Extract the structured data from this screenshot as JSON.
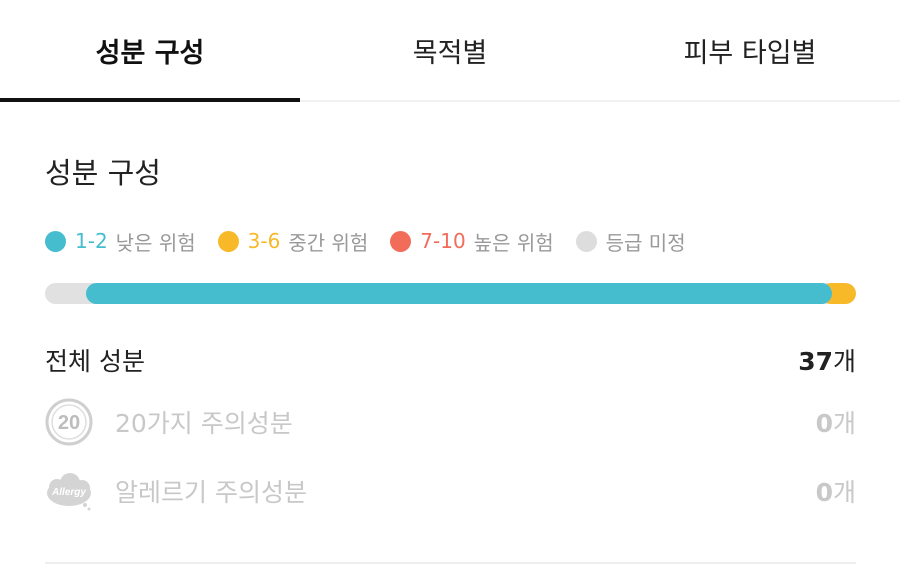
{
  "tabs": [
    {
      "label": "성분 구성",
      "active": true
    },
    {
      "label": "목적별",
      "active": false
    },
    {
      "label": "피부 타입별",
      "active": false
    }
  ],
  "section": {
    "title": "성분 구성"
  },
  "legend": [
    {
      "range": "1-2",
      "text": "낮은 위험",
      "color": "#45BDCF",
      "icon": "low-risk-dot-icon"
    },
    {
      "range": "3-6",
      "text": "중간 위험",
      "color": "#F7B928",
      "icon": "medium-risk-dot-icon"
    },
    {
      "range": "7-10",
      "text": "높은 위험",
      "color": "#F26C5A",
      "icon": "high-risk-dot-icon"
    },
    {
      "range": "",
      "text": "등급 미정",
      "color": "#DDDDDD",
      "icon": "unrated-dot-icon"
    }
  ],
  "composition": {
    "unrated_fraction": 0.05,
    "low_fraction": 0.92,
    "medium_fraction": 0.03,
    "high_fraction": 0.0
  },
  "summary": {
    "total": {
      "label": "전체 성분",
      "count": "37",
      "unit": "개"
    },
    "caution20": {
      "label": "20가지 주의성분",
      "count": "0",
      "unit": "개",
      "icon_text": "20",
      "icon": "twenty-caution-icon"
    },
    "allergy": {
      "label": "알레르기 주의성분",
      "count": "0",
      "unit": "개",
      "icon_text": "Allergy",
      "icon": "allergy-icon"
    }
  }
}
